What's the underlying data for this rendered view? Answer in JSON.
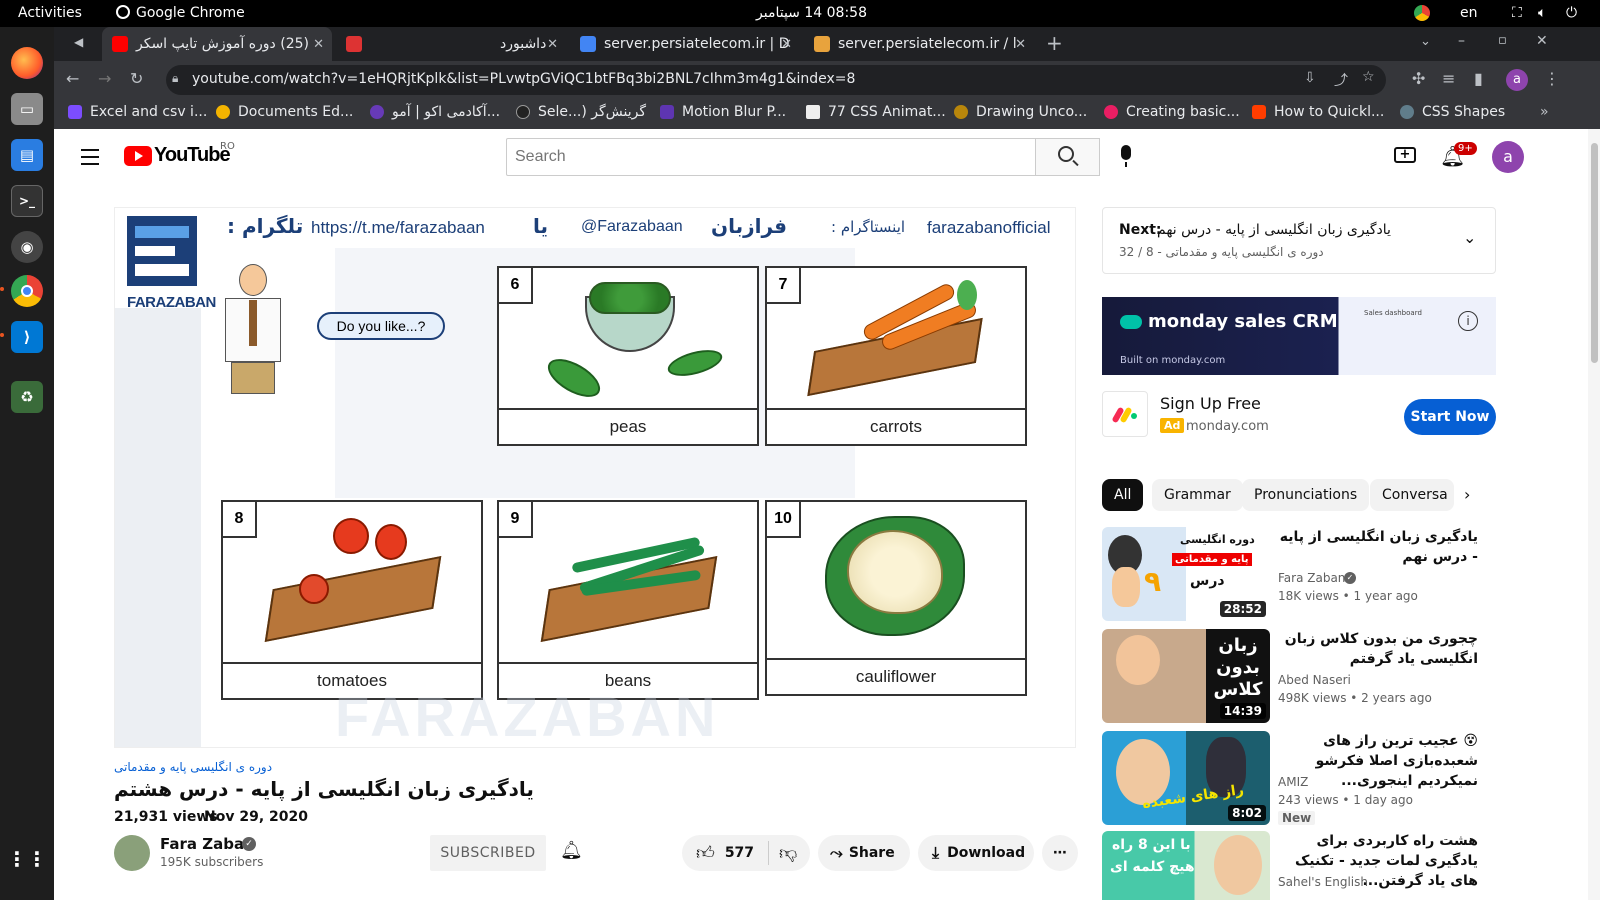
{
  "topbar": {
    "activities": "Activities",
    "app": "Google Chrome",
    "clock": "08:58 14 سپتامبر",
    "lang": "en"
  },
  "tabs": [
    {
      "title": "(25) دوره آموزش تایپ اسکر",
      "fav_color": "#ff0000"
    },
    {
      "title": "داشبورد",
      "fav_color": "#d33"
    },
    {
      "title": "server.persiatelecom.ir | D",
      "fav_color": "#4285f4"
    },
    {
      "title": "server.persiatelecom.ir / l",
      "fav_color": "#e8a33d"
    }
  ],
  "new_tab": "+",
  "omnibox": {
    "url": "youtube.com/watch?v=1eHQRjtKplk&list=PLvwtpGViQC1btFBq3bi2BNL7cIhm3m4g1&index=8"
  },
  "profile_initial": "a",
  "bookmarks": [
    {
      "label": "Excel and csv i...",
      "color": "#7c4dff"
    },
    {
      "label": "Documents Ed...",
      "color": "#f4b400"
    },
    {
      "label": "آکادمی اکو | آمو...",
      "color": "#673ab7"
    },
    {
      "label": "Sele...) گرینش‌گر",
      "color": "#222"
    },
    {
      "label": "Motion Blur P...",
      "color": "#5e35b1"
    },
    {
      "label": "77 CSS Animat...",
      "color": "#333"
    },
    {
      "label": "Drawing Unco...",
      "color": "#b8860b"
    },
    {
      "label": "Creating basic...",
      "color": "#e91e63"
    },
    {
      "label": "How to Quickl...",
      "color": "#ff3d00"
    },
    {
      "label": "CSS Shapes",
      "color": "#607d8b"
    }
  ],
  "yt": {
    "logo_text": "YouTube",
    "region": "RO",
    "search_placeholder": "Search",
    "notif_count": "9+",
    "avatar": "a"
  },
  "video_frame": {
    "telegram_label": "تلگرام :",
    "telegram_url": "https://t.me/farazabaan",
    "or": "یا",
    "handle": "@Farazabaan",
    "brand_fa": "فرازبان",
    "instagram_label": "اینستاگرام :",
    "instagram": "farazabanofficial",
    "logo_text": "FARAZABAN",
    "speech": "Do you like...?",
    "watermark": "FARAZABAN",
    "cards": [
      {
        "num": "6",
        "word": "peas"
      },
      {
        "num": "7",
        "word": "carrots"
      },
      {
        "num": "8",
        "word": "tomatoes"
      },
      {
        "num": "9",
        "word": "beans"
      },
      {
        "num": "10",
        "word": "cauliflower"
      }
    ]
  },
  "video": {
    "playlist": "دوره ی انگلیسی پایه و مقدماتی",
    "title": "یادگیری زبان انگلیسی از پایه - درس هشتم",
    "views": "21,931 views",
    "date": "Nov 29, 2020",
    "channel": "Fara Zaban",
    "subscribers": "195K subscribers",
    "subscribed": "SUBSCRIBED",
    "likes": "577",
    "share": "Share",
    "download": "Download"
  },
  "next": {
    "label": "Next:",
    "title": "یادگیری زبان انگلیسی از پایه - درس نهم",
    "sub": "دوره ی انگلیسی پایه و مقدماتی - 8 / 32"
  },
  "ad": {
    "banner_brand": "monday sales CRM",
    "banner_sub": "Sales dashboard",
    "built_on": "Built on monday.com",
    "title": "Sign Up Free",
    "badge": "Ad",
    "domain": "monday.com",
    "cta": "Start Now"
  },
  "chips": [
    "All",
    "Grammar",
    "Pronunciations",
    "Conversa"
  ],
  "recs": [
    {
      "title": "یادگیری زبان انگلیسی از پایه - درس نهم",
      "channel": "Fara Zaban",
      "meta": "18K views • 1 year ago",
      "duration": "28:52",
      "thumb_text": "دوره انگلیسی",
      "thumb_text2": "پایه و مقدماتی",
      "thumb_text3": "درس",
      "badge": ""
    },
    {
      "title": "چجوری من بدون کلاس زبان انگلیسی یاد گرفتم",
      "channel": "Abed Naseri",
      "meta": "498K views • 2 years ago",
      "duration": "14:39",
      "thumb_text": "زبان بدون کلاس",
      "thumb_text2": "",
      "thumb_text3": "",
      "badge": ""
    },
    {
      "title": "😵 عجیب ترین راز های شعبده‌بازی اصلا فکرشو نمیکردیم اینجوری...",
      "channel": "AMIZ",
      "meta": "243 views • 1 day ago",
      "duration": "8:02",
      "thumb_text": "راز های شعبده",
      "thumb_text2": "",
      "thumb_text3": "",
      "badge": "New"
    },
    {
      "title": "هشت راه کاربردی برای یادگیری لمات جدید - تکنیک های یاد گرفتن...",
      "channel": "Sahel's English",
      "meta": "",
      "duration": "",
      "thumb_text": "با این 8 راه",
      "thumb_text2": "هیچ کلمه ای",
      "thumb_text3": "",
      "badge": ""
    }
  ],
  "colors": {
    "yt_red": "#ff0000",
    "blue": "#065fd4",
    "chrome_dark": "#202124",
    "chrome_toolbar": "#35363a"
  }
}
